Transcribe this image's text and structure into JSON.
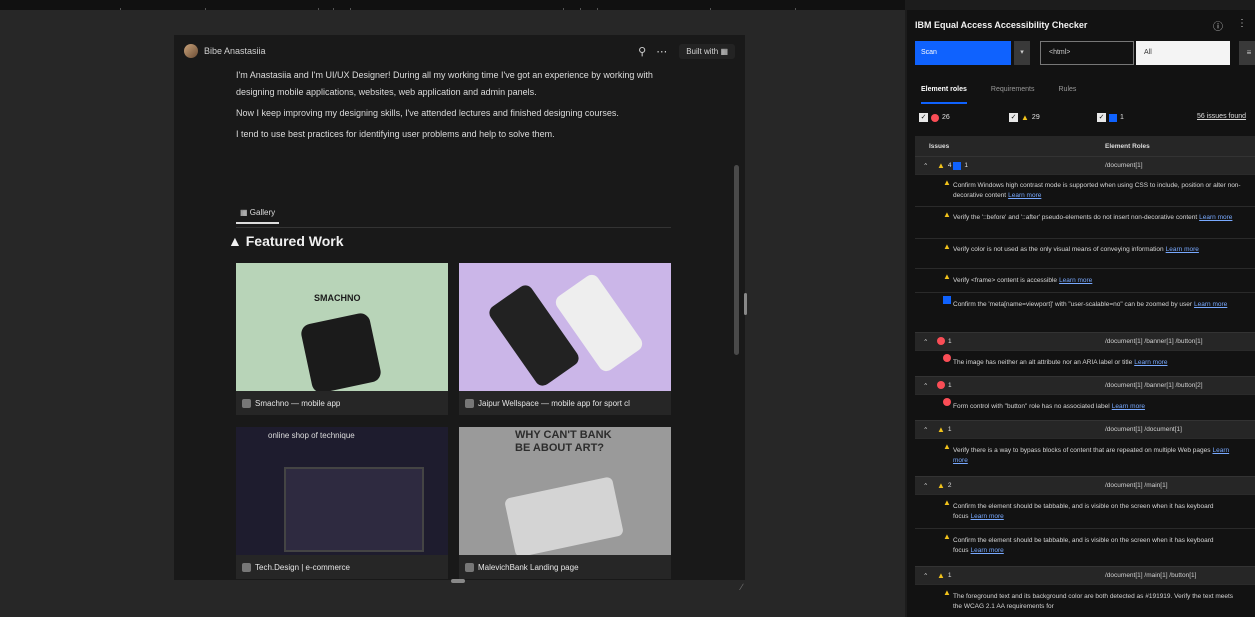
{
  "page": {
    "author": "Bibe Anastasiia",
    "built_with": "Built with",
    "paragraphs": [
      "I'm Anastasiia and I'm UI/UX Designer! During all my working time I've got an experience by working with designing mobile applications, websites, web application and admin panels.",
      "Now I keep improving my designing skills, I've attended lectures and finished designing courses.",
      "I tend to use best practices for identifying user problems and help to solve them."
    ],
    "gallery_tab": "Gallery",
    "featured_title": "Featured Work",
    "cards": [
      {
        "caption": "Smachno — mobile app",
        "thumb_text": "SMACHNO"
      },
      {
        "caption": "Jaipur Wellspace — mobile app for sport cl",
        "thumb_text": ""
      },
      {
        "caption": "Tech.Design | e-commerce",
        "thumb_text": "online shop of technique"
      },
      {
        "caption": "MalevichBank Landing page",
        "thumb_text": "WHY CAN'T BANK BE ABOUT ART?"
      }
    ]
  },
  "panel": {
    "title": "IBM Equal Access Accessibility Checker",
    "scan_select": "Scan",
    "html_select": "<html>",
    "all_select": "All",
    "tabs": [
      "Element roles",
      "Requirements",
      "Rules"
    ],
    "counts": {
      "violations": "26",
      "needs_review": "29",
      "recommendations": "1",
      "issues_found": "56 issues found"
    },
    "table_headers": {
      "issues": "Issues",
      "roles": "Element Roles"
    },
    "groups": [
      {
        "counts": "4",
        "extra": "1",
        "xpath": "/document[1]",
        "type": "warn"
      },
      {
        "counts": "1",
        "extra": "",
        "xpath": "/document[1] /banner[1] /button[1]",
        "type": "error"
      },
      {
        "counts": "1",
        "extra": "",
        "xpath": "/document[1] /banner[1] /button[2]",
        "type": "error"
      },
      {
        "counts": "1",
        "extra": "",
        "xpath": "/document[1] /document[1]",
        "type": "warn"
      },
      {
        "counts": "2",
        "extra": "",
        "xpath": "/document[1] /main[1]",
        "type": "warn"
      },
      {
        "counts": "1",
        "extra": "",
        "xpath": "/document[1] /main[1] /button[1]",
        "type": "warn"
      }
    ],
    "messages": [
      "Confirm Windows high contrast mode is supported when using CSS to include, position or alter non-decorative content",
      "Verify the '::before' and '::after' pseudo-elements do not insert non-decorative content",
      "Verify color is not used as the only visual means of conveying information",
      "Verify <frame> content is accessible",
      "Confirm the 'meta[name=viewport]' with \"user-scalable=no\" can be zoomed by user",
      "The image has neither an alt attribute nor an ARIA label or title",
      "Form control with \"button\" role has no associated label",
      "Verify there is a way to bypass blocks of content that are repeated on multiple Web pages",
      "Confirm the element should be tabbable, and is visible on the screen when it has keyboard focus",
      "Confirm the element should be tabbable, and is visible on the screen when it has keyboard focus",
      "The foreground text and its background color are both detected as #191919. Verify the text meets the WCAG 2.1 AA requirements for"
    ],
    "learn_more": "Learn more"
  }
}
